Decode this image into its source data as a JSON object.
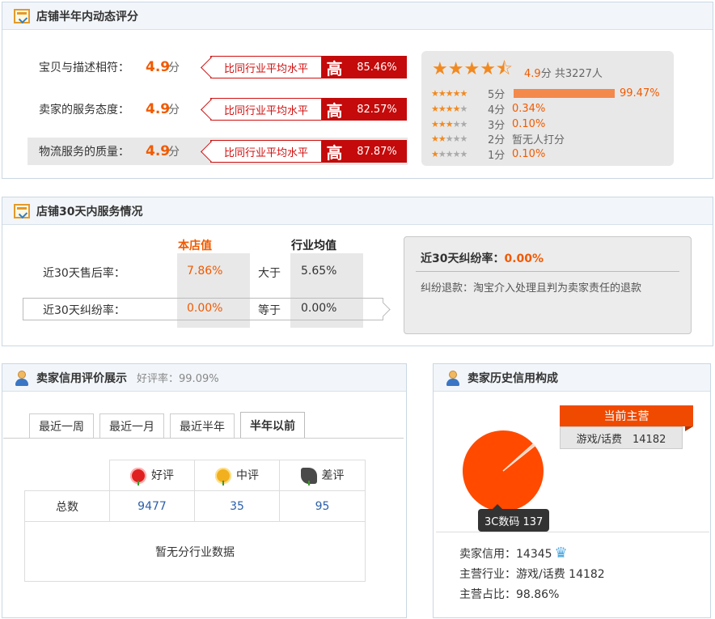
{
  "dynamic_rating": {
    "title": "店铺半年内动态评分",
    "rows": [
      {
        "label": "宝贝与描述相符：",
        "score": "4.9",
        "unit": "分",
        "compare": "比同行业平均水平",
        "level": "高",
        "percent": "85.46%"
      },
      {
        "label": "卖家的服务态度：",
        "score": "4.9",
        "unit": "分",
        "compare": "比同行业平均水平",
        "level": "高",
        "percent": "82.57%"
      },
      {
        "label": "物流服务的质量：",
        "score": "4.9",
        "unit": "分",
        "compare": "比同行业平均水平",
        "level": "高",
        "percent": "87.87%"
      }
    ],
    "summary": {
      "score": "4.9",
      "unit": "分",
      "count": "共3227人",
      "stars": 4.5
    },
    "distribution": [
      {
        "stars": 5,
        "label": "5分",
        "percent": "99.47%",
        "fraction": 0.9947
      },
      {
        "stars": 4,
        "label": "4分",
        "percent": "0.34%",
        "fraction": 0.0034
      },
      {
        "stars": 3,
        "label": "3分",
        "percent": "0.10%",
        "fraction": 0.001
      },
      {
        "stars": 2,
        "label": "2分",
        "text": "暂无人打分"
      },
      {
        "stars": 1,
        "label": "1分",
        "percent": "0.10%",
        "fraction": 0.001
      }
    ],
    "colors": {
      "accent": "#f05a00",
      "high": "#c40a0a",
      "bar": "#f4894c"
    }
  },
  "service30": {
    "title": "店铺30天内服务情况",
    "col_store": "本店值",
    "col_industry": "行业均值",
    "rows": [
      {
        "label": "近30天售后率：",
        "store": "7.86%",
        "relation": "大于",
        "industry": "5.65%"
      },
      {
        "label": "近30天纠纷率：",
        "store": "0.00%",
        "relation": "等于",
        "industry": "0.00%"
      }
    ],
    "dispute": {
      "title": "近30天纠纷率：",
      "value": "0.00%",
      "desc": "纠纷退款：淘宝介入处理且判为卖家责任的退款"
    }
  },
  "credit": {
    "title": "卖家信用评价展示",
    "good_rate_label": "好评率：",
    "good_rate": "99.09%",
    "tabs": [
      "最近一周",
      "最近一月",
      "最近半年",
      "半年以前"
    ],
    "active_tab": 3,
    "headers": {
      "good": "好评",
      "mid": "中评",
      "bad": "差评"
    },
    "row_label": "总数",
    "values": {
      "good": "9477",
      "mid": "35",
      "bad": "95"
    },
    "no_data": "暂无分行业数据"
  },
  "history": {
    "title": "卖家历史信用构成",
    "current_label": "当前主营",
    "current_value": "游戏/话费　14182",
    "tooltip": "3C数码 137",
    "chart_data": {
      "type": "pie",
      "slices": [
        {
          "name": "游戏/话费",
          "value": 14182
        },
        {
          "name": "3C数码",
          "value": 137
        }
      ],
      "colors": [
        "#ff4a00",
        "#ffc8b0"
      ]
    },
    "seller_credit_label": "卖家信用：",
    "seller_credit": "14345",
    "main_industry_label": "主营行业：",
    "main_industry": "游戏/话费 14182",
    "main_ratio_label": "主营占比：",
    "main_ratio": "98.86%"
  }
}
